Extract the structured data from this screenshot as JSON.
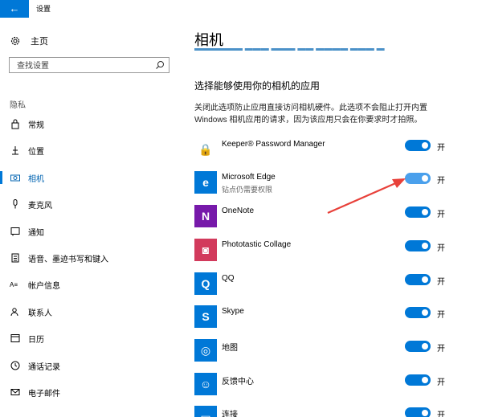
{
  "window": {
    "back_glyph": "←",
    "title": "设置"
  },
  "sidebar": {
    "home_label": "主页",
    "search_placeholder": "查找设置",
    "section_label": "隐私",
    "items": [
      {
        "label": "常规",
        "icon": "lock-icon"
      },
      {
        "label": "位置",
        "icon": "location-icon"
      },
      {
        "label": "相机",
        "icon": "camera-icon",
        "active": true
      },
      {
        "label": "麦克风",
        "icon": "microphone-icon"
      },
      {
        "label": "通知",
        "icon": "notification-icon"
      },
      {
        "label": "语音、墨迹书写和键入",
        "icon": "clipboard-icon"
      },
      {
        "label": "帐户信息",
        "icon": "account-info-icon"
      },
      {
        "label": "联系人",
        "icon": "contacts-icon"
      },
      {
        "label": "日历",
        "icon": "calendar-icon"
      },
      {
        "label": "通话记录",
        "icon": "call-history-icon"
      },
      {
        "label": "电子邮件",
        "icon": "email-icon"
      }
    ]
  },
  "main": {
    "title": "相机",
    "section_heading": "选择能够使用你的相机的应用",
    "description": "关闭此选项防止应用直接访问相机硬件。此选项不会阻止打开内置 Windows 相机应用的请求，因为该应用只会在你要求时才拍照。",
    "apps": [
      {
        "name": "Keeper® Password Manager",
        "icon": "keeper-lock-icon",
        "icon_color": "#ffffff",
        "glyph": "🔒",
        "toggle": "开",
        "state": "on"
      },
      {
        "name": "Microsoft Edge",
        "subtitle": "钻点仍需要权限",
        "icon": "edge-icon",
        "icon_color": "#0078d7",
        "glyph": "e",
        "toggle": "开",
        "state": "on"
      },
      {
        "name": "OneNote",
        "icon": "onenote-icon",
        "icon_color": "#7719aa",
        "glyph": "N",
        "toggle": "开",
        "state": "on"
      },
      {
        "name": "Phototastic Collage",
        "icon": "phototastic-icon",
        "icon_color": "#d23a5c",
        "glyph": "◙",
        "toggle": "开",
        "state": "on"
      },
      {
        "name": "QQ",
        "icon": "qq-icon",
        "icon_color": "#0078d7",
        "glyph": "Q",
        "toggle": "开",
        "state": "on"
      },
      {
        "name": "Skype",
        "icon": "skype-icon",
        "icon_color": "#0078d7",
        "glyph": "S",
        "toggle": "开",
        "state": "on"
      },
      {
        "name": "地图",
        "icon": "maps-icon",
        "icon_color": "#0078d7",
        "glyph": "◎",
        "toggle": "开",
        "state": "on"
      },
      {
        "name": "反馈中心",
        "icon": "feedback-hub-icon",
        "icon_color": "#0078d7",
        "glyph": "☺",
        "toggle": "开",
        "state": "on"
      },
      {
        "name": "连接",
        "icon": "connect-icon",
        "icon_color": "#0078d7",
        "glyph": "▭",
        "toggle": "开",
        "state": "on"
      }
    ]
  },
  "colors": {
    "accent": "#0078d7",
    "arrow": "#e8413a"
  }
}
